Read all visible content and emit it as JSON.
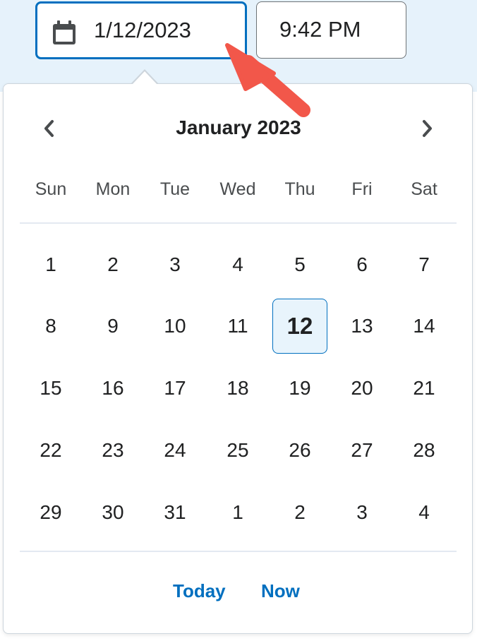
{
  "date_input": {
    "value": "1/12/2023",
    "icon": "calendar-icon"
  },
  "time_input": {
    "value": "9:42 PM"
  },
  "calendar": {
    "month_title": "January 2023",
    "prev_icon": "chevron-left-icon",
    "next_icon": "chevron-right-icon",
    "weekdays": [
      "Sun",
      "Mon",
      "Tue",
      "Wed",
      "Thu",
      "Fri",
      "Sat"
    ],
    "weeks": [
      [
        "1",
        "2",
        "3",
        "4",
        "5",
        "6",
        "7"
      ],
      [
        "8",
        "9",
        "10",
        "11",
        "12",
        "13",
        "14"
      ],
      [
        "15",
        "16",
        "17",
        "18",
        "19",
        "20",
        "21"
      ],
      [
        "22",
        "23",
        "24",
        "25",
        "26",
        "27",
        "28"
      ],
      [
        "29",
        "30",
        "31",
        "1",
        "2",
        "3",
        "4"
      ]
    ],
    "selected_day": "12",
    "today_label": "Today",
    "now_label": "Now"
  },
  "colors": {
    "accent": "#006fbf",
    "annotation_arrow": "#f2574a",
    "selected_bg": "#e8f4fc"
  }
}
